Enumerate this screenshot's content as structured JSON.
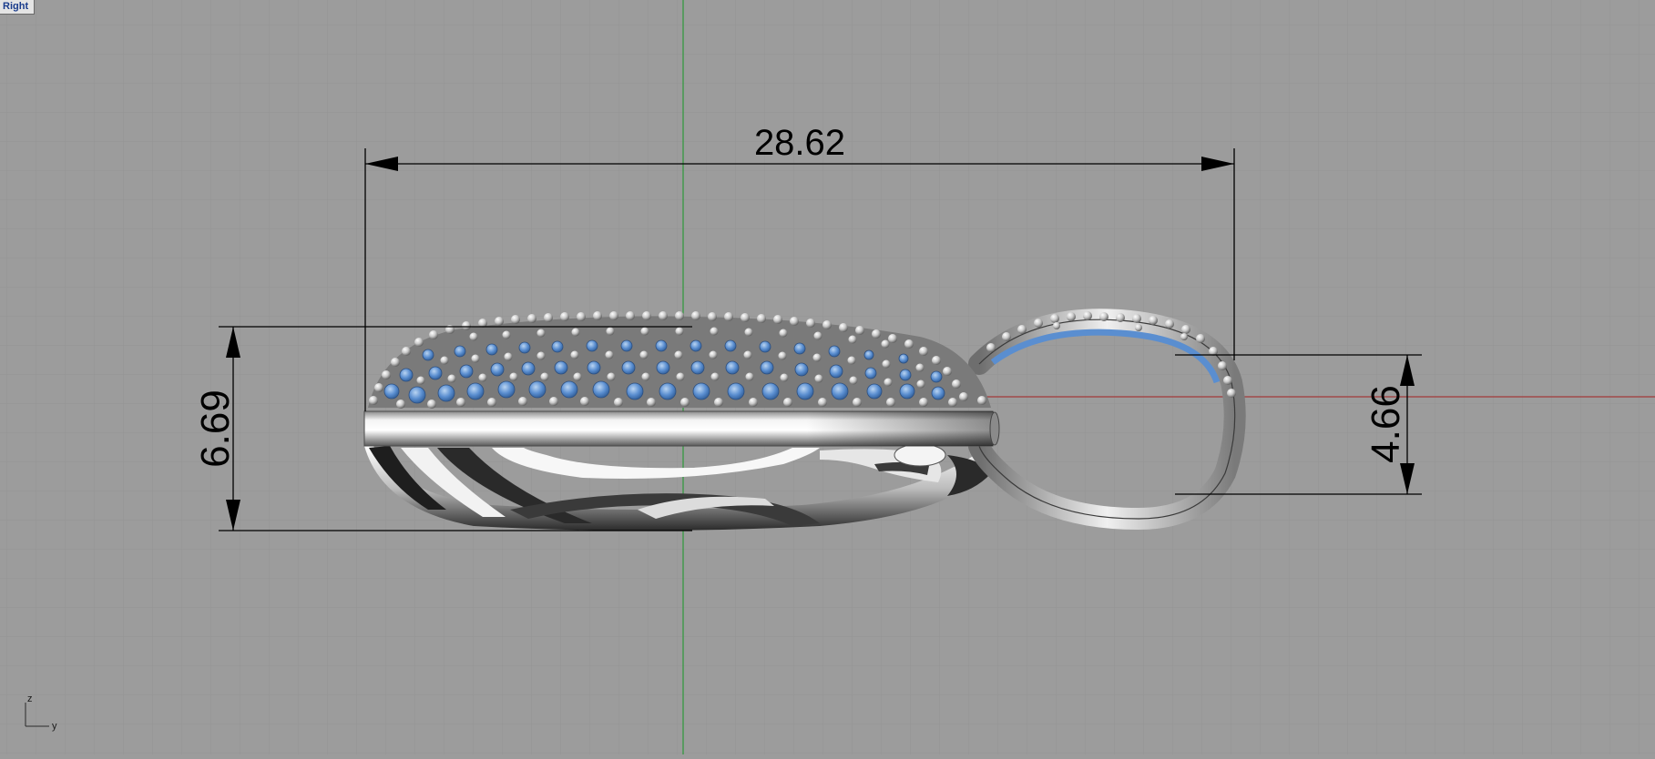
{
  "viewport": {
    "name": "Right"
  },
  "dimensions": {
    "width": "28.62",
    "height_left": "6.69",
    "height_right": "4.66"
  },
  "axis_icon": {
    "vertical": "z",
    "horizontal": "y"
  },
  "colors": {
    "background": "#9c9c9c",
    "grid": "#8f8f8f",
    "world_x_axis": "#a33a3a",
    "world_y_axis": "#2f9a3a",
    "dimension_line": "#000000",
    "gem": "#5a8ed0",
    "metal": "#d8d8d8"
  },
  "icons": {
    "axis_widget": "axis-triad-icon"
  }
}
